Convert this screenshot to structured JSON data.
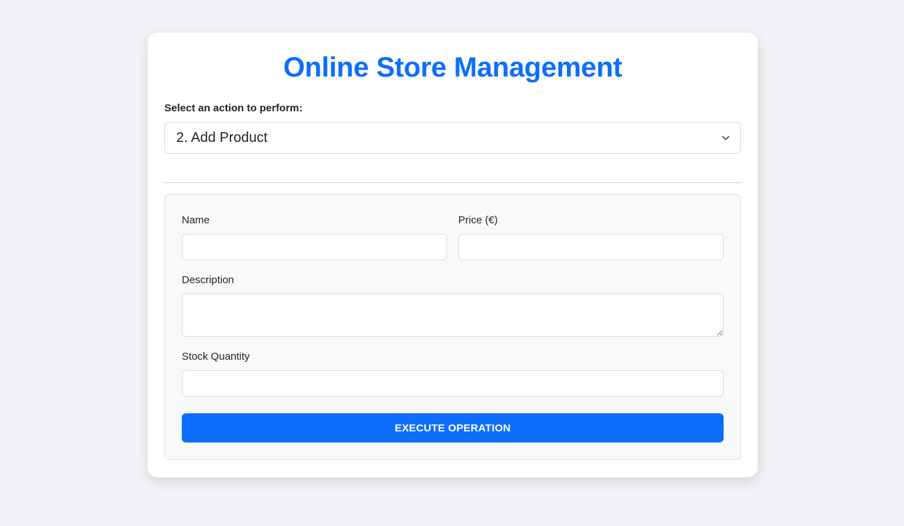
{
  "page": {
    "title": "Online Store Management",
    "background": "#f0f2f5",
    "accent": "#0d6efd"
  },
  "action": {
    "label": "Select an action to perform:",
    "selected": "2. Add Product",
    "icon": "chevron-down-icon"
  },
  "form": {
    "name_label": "Name",
    "name_value": "",
    "price_label": "Price (€)",
    "price_value": "",
    "description_label": "Description",
    "description_value": "",
    "stock_label": "Stock Quantity",
    "stock_value": "",
    "submit_label": "EXECUTE OPERATION"
  }
}
